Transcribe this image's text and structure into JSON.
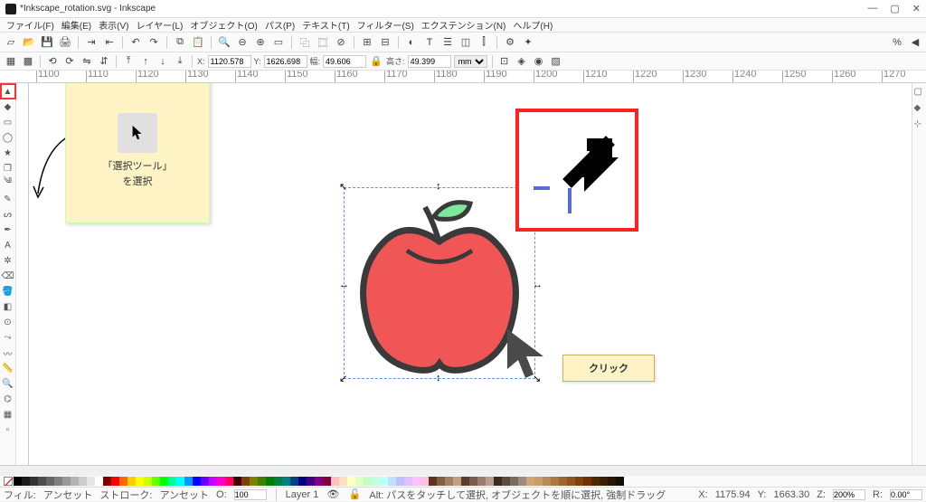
{
  "title": "*Inkscape_rotation.svg - Inkscape",
  "menus": [
    "ファイル(F)",
    "編集(E)",
    "表示(V)",
    "レイヤー(L)",
    "オブジェクト(O)",
    "パス(P)",
    "テキスト(T)",
    "フィルター(S)",
    "エクステンション(N)",
    "ヘルプ(H)"
  ],
  "callout1_line1": "「選択ツール」",
  "callout1_line2": "を選択",
  "callout2": "クリック",
  "coords": {
    "x_label": "X:",
    "x": "1120.578",
    "y_label": "Y:",
    "y": "1626.698",
    "w_label": "幅:",
    "w": "49.606",
    "h_label": "高さ:",
    "h": "49.399",
    "unit": "mm"
  },
  "status": {
    "fill_label": "フィル:",
    "fill_val": "アンセット",
    "stroke_label": "ストローク:",
    "stroke_val": "アンセット",
    "opacity_label": "O:",
    "opacity": "100",
    "layer": "Layer 1",
    "hint": "Alt: パスをタッチして選択, オブジェクトを順に選択, 強制ドラッグ",
    "cursor_x_label": "X:",
    "cursor_x": "1175.94",
    "cursor_y_label": "Y:",
    "cursor_y": "1663.30",
    "zoom_label": "Z:",
    "zoom": "200%",
    "rot_label": "R:",
    "rot": "0.00°"
  },
  "ruler_ticks": [
    "1100",
    "1110",
    "1120",
    "1130",
    "1140",
    "1150",
    "1160",
    "1170",
    "1180",
    "1190",
    "1200",
    "1210",
    "1220",
    "1230",
    "1240",
    "1250",
    "1260",
    "1270"
  ],
  "palette": [
    "#000000",
    "#1a1a1a",
    "#333333",
    "#4d4d4d",
    "#666666",
    "#808080",
    "#999999",
    "#b3b3b3",
    "#cccccc",
    "#e6e6e6",
    "#ffffff",
    "#800000",
    "#ff0000",
    "#ff6600",
    "#ffcc00",
    "#ffff00",
    "#ccff00",
    "#66ff00",
    "#00ff00",
    "#00ff99",
    "#00ffff",
    "#0099ff",
    "#0000ff",
    "#6600ff",
    "#cc00ff",
    "#ff00cc",
    "#ff0066",
    "#400000",
    "#804000",
    "#808000",
    "#408000",
    "#008000",
    "#008040",
    "#008080",
    "#004080",
    "#000080",
    "#400080",
    "#800080",
    "#800040",
    "#ffc0c0",
    "#ffe0c0",
    "#ffffc0",
    "#e0ffc0",
    "#c0ffc0",
    "#c0ffe0",
    "#c0ffff",
    "#c0e0ff",
    "#c0c0ff",
    "#e0c0ff",
    "#ffc0ff",
    "#ffc0e0",
    "#603020",
    "#806040",
    "#a08060",
    "#c0a080",
    "#5a3d2e",
    "#7a5d4e",
    "#9a7d6e",
    "#ba9d8e",
    "#3a2d1e",
    "#5a4d3e",
    "#7a6d5e",
    "#9a8d7e",
    "#d4a373",
    "#c69c6d",
    "#b88a5a",
    "#aa7847",
    "#9c6634",
    "#8e5421",
    "#80420e",
    "#723000",
    "#4a2800",
    "#382000",
    "#261800",
    "#141000"
  ]
}
